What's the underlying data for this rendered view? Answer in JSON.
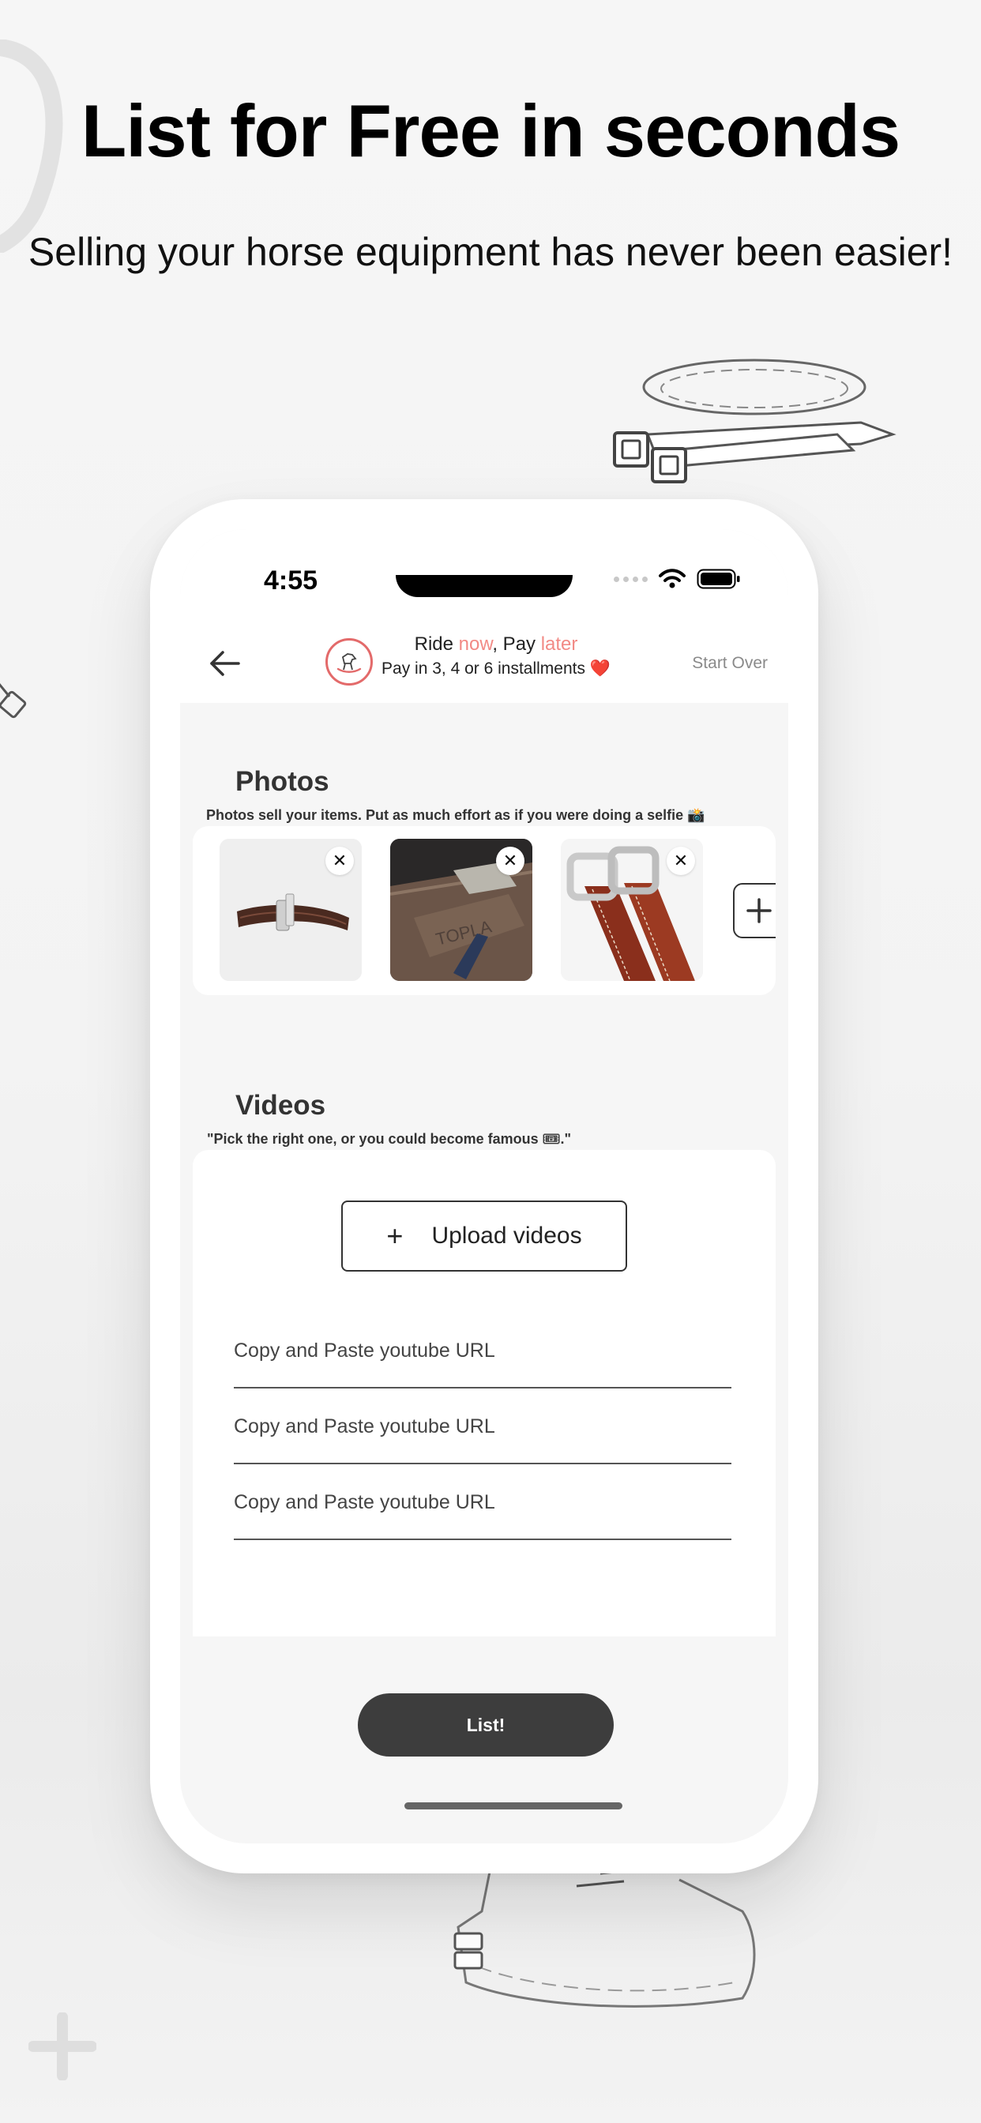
{
  "hero": {
    "title": "List for Free in seconds",
    "subtitle": "Selling your horse equipment has never been easier!"
  },
  "status_bar": {
    "time": "4:55"
  },
  "nav": {
    "promo_ride": "Ride ",
    "promo_now": "now",
    "promo_pay": ", Pay ",
    "promo_later": "later",
    "promo_installments": "Pay in 3, 4 or 6 installments ❤️",
    "start_over": "Start Over"
  },
  "photos": {
    "title": "Photos",
    "subtitle": "Photos sell your items. Put as much effort as if you were doing a selfie 📸",
    "items": [
      {
        "alt": "Brown leather stirrup leather"
      },
      {
        "alt": "Leather strap close-up"
      },
      {
        "alt": "Brown stirrup leathers with buckles"
      }
    ]
  },
  "videos": {
    "title": "Videos",
    "subtitle": "\"Pick the right one, or you could become famous 🎟.\"",
    "upload_label": "Upload videos",
    "url_placeholders": [
      "Copy and Paste youtube URL",
      "Copy and Paste youtube URL",
      "Copy and Paste youtube URL"
    ]
  },
  "actions": {
    "list_label": "List!"
  },
  "colors": {
    "accent": "#f28a85",
    "button_dark": "#3d3d3d",
    "logo_ring": "#e36a6a"
  }
}
